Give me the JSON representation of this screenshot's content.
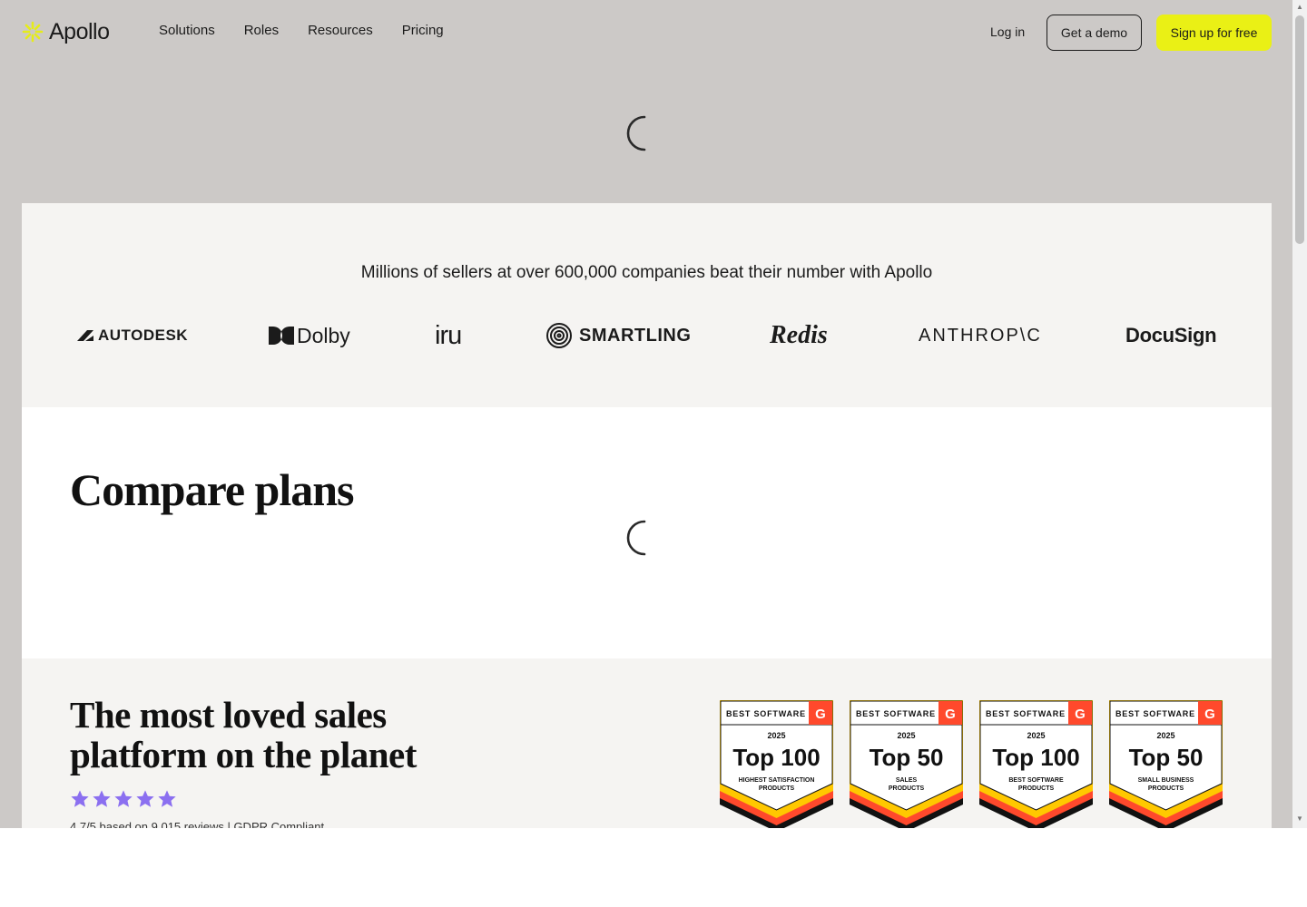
{
  "header": {
    "logo_text": "Apollo",
    "nav": [
      "Solutions",
      "Roles",
      "Resources",
      "Pricing"
    ],
    "login": "Log in",
    "demo": "Get a demo",
    "signup": "Sign up for free"
  },
  "logos_section": {
    "heading": "Millions of sellers at over 600,000 companies beat their number with Apollo",
    "logos": [
      "AUTODESK",
      "Dolby",
      "iru",
      "SMARTLING",
      "Redis",
      "ANTHROP\\C",
      "DocuSign"
    ]
  },
  "compare": {
    "title": "Compare plans"
  },
  "loved": {
    "title": "The most loved sales platform on the planet",
    "rating_text": "4.7/5 based on 9,015 reviews | GDPR Compliant",
    "star_count": 5
  },
  "badges": [
    {
      "header": "BEST SOFTWARE",
      "year": "2025",
      "rank": "Top 100",
      "line1": "HIGHEST SATISFACTION",
      "line2": "PRODUCTS"
    },
    {
      "header": "BEST SOFTWARE",
      "year": "2025",
      "rank": "Top 50",
      "line1": "SALES",
      "line2": "PRODUCTS"
    },
    {
      "header": "BEST SOFTWARE",
      "year": "2025",
      "rank": "Top 100",
      "line1": "BEST SOFTWARE",
      "line2": "PRODUCTS"
    },
    {
      "header": "BEST SOFTWARE",
      "year": "2025",
      "rank": "Top 50",
      "line1": "SMALL BUSINESS",
      "line2": "PRODUCTS"
    }
  ],
  "colors": {
    "page_bg": "#ccc9c7",
    "band_bg": "#f5f4f2",
    "accent_yellow": "#eaf015",
    "star_purple": "#8b6ff0",
    "g2_red": "#ff492c"
  }
}
